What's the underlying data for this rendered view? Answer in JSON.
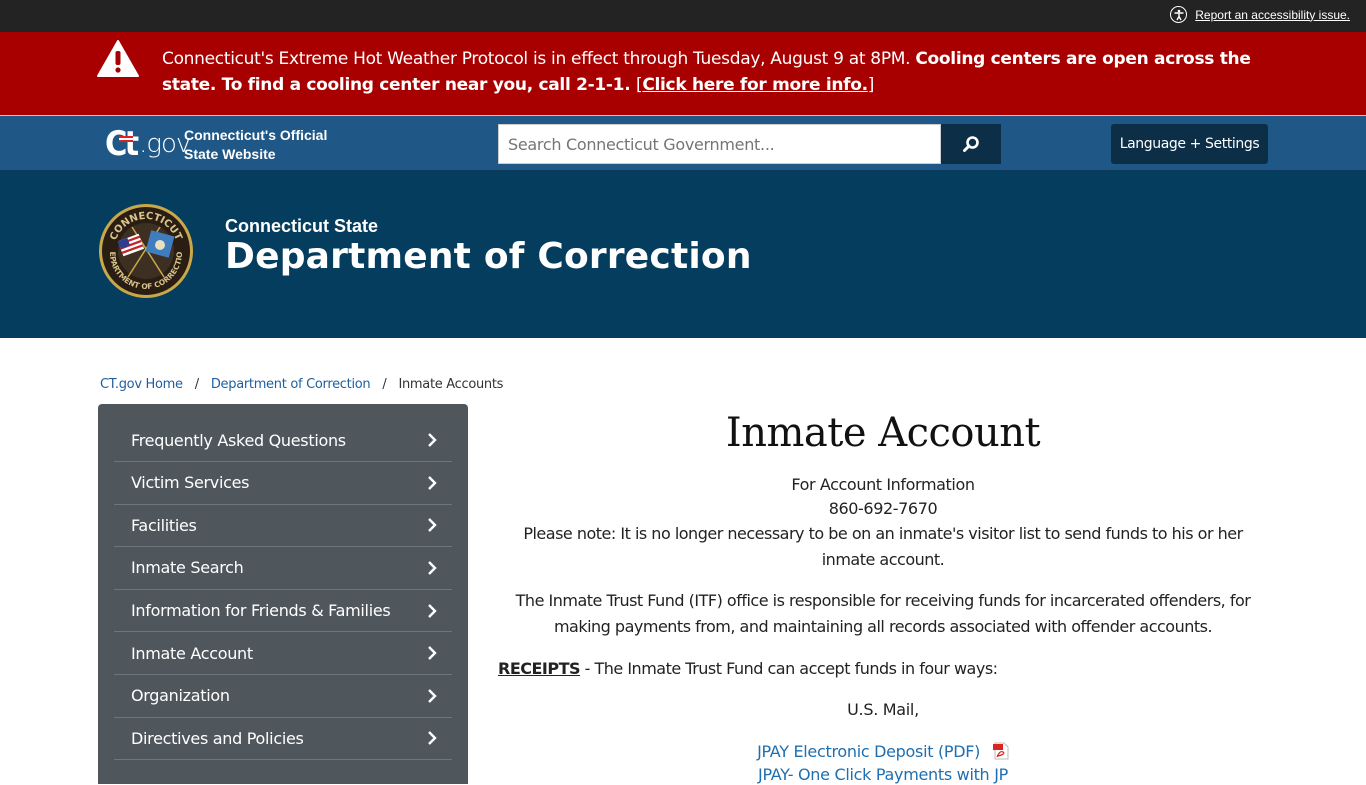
{
  "utility": {
    "accessibility_link": "Report an accessibility issue."
  },
  "alert": {
    "text_normal": "Connecticut's Extreme Hot Weather Protocol is in effect through Tuesday, August 9 at 8PM. ",
    "text_bold": "Cooling centers are open across the state. To find a cooling center near you, call 2-1-1. ",
    "bracket_open": "[",
    "link": "Click here for more info.",
    "bracket_close": "]",
    "color": "#a80000"
  },
  "header": {
    "logo_ct": "Ct",
    "logo_gov": ".gov",
    "tagline_line1": "Connecticut's Official",
    "tagline_line2": "State Website",
    "search_placeholder": "Search Connecticut Government...",
    "language_button": "Language + Settings",
    "color": "#1f5787"
  },
  "agency": {
    "subtitle": "Connecticut State",
    "title": "Department of Correction",
    "seal_top": "CONNECTICUT",
    "seal_bottom": "DEPARTMENT OF CORRECTION",
    "color": "#053d5f"
  },
  "breadcrumb": [
    {
      "label": "CT.gov Home",
      "link": true
    },
    {
      "label": "Department of Correction",
      "link": true
    },
    {
      "label": "Inmate Accounts",
      "link": false
    }
  ],
  "breadcrumb_separator": "/",
  "sidebar": {
    "items": [
      {
        "label": "Frequently Asked Questions"
      },
      {
        "label": "Victim Services"
      },
      {
        "label": "Facilities"
      },
      {
        "label": "Inmate Search"
      },
      {
        "label": "Information for Friends & Families"
      },
      {
        "label": "Inmate Account"
      },
      {
        "label": "Organization"
      },
      {
        "label": "Directives and Policies"
      }
    ]
  },
  "main": {
    "title": "Inmate Account",
    "account_info_label": "For Account Information",
    "phone": "860-692-7670",
    "note": "Please note: It is no longer necessary to be on an inmate's visitor list to send funds to his or her inmate account.",
    "itf_paragraph": "The Inmate Trust Fund (ITF) office is responsible for receiving funds for incarcerated offenders, for making payments from, and maintaining all records associated with offender accounts.",
    "receipts_label": "RECEIPTS",
    "receipts_text": " - The Inmate Trust Fund can accept funds in four ways:",
    "mail": "U.S. Mail,",
    "links": [
      {
        "label": "JPAY Electronic Deposit (PDF)",
        "icon": "pdf-icon"
      },
      {
        "label": "JPAY- One Click Payments with JP"
      }
    ]
  }
}
